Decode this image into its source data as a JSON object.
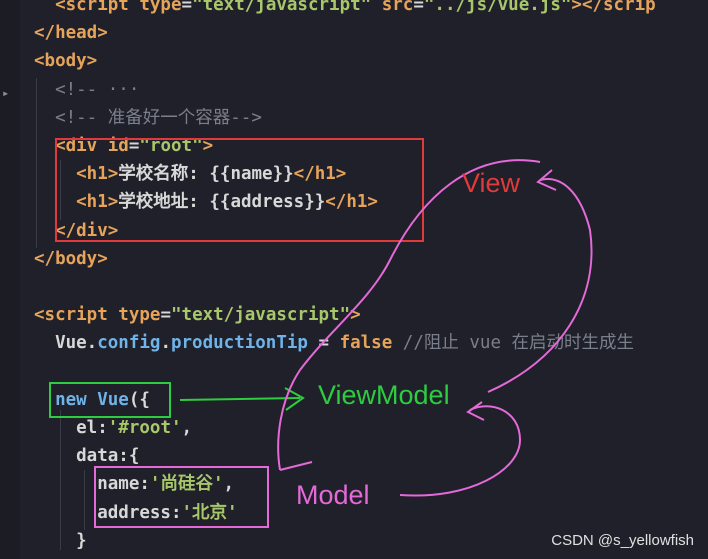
{
  "code_lines": [
    {
      "id": "l1",
      "parts": [
        [
          "tag",
          "  <script "
        ],
        [
          "attr",
          "type"
        ],
        [
          "punc",
          "="
        ],
        [
          "str",
          "\"text/javascript\""
        ],
        [
          "attr",
          " src"
        ],
        [
          "punc",
          "="
        ],
        [
          "str",
          "\"../js/vue.js\""
        ],
        [
          "tag",
          "></scrip"
        ]
      ]
    },
    {
      "id": "l2",
      "parts": [
        [
          "tag",
          "</head>"
        ]
      ]
    },
    {
      "id": "l3",
      "parts": [
        [
          "tag",
          "<body>"
        ]
      ]
    },
    {
      "id": "l4",
      "parts": [
        [
          "cmt",
          "  <!-- ···"
        ]
      ]
    },
    {
      "id": "l5",
      "parts": [
        [
          "cmt",
          "  <!-- 准备好一个容器-->"
        ]
      ]
    },
    {
      "id": "l6",
      "parts": [
        [
          "tag",
          "  <div "
        ],
        [
          "attr",
          "id"
        ],
        [
          "punc",
          "="
        ],
        [
          "str",
          "\"root\""
        ],
        [
          "tag",
          ">"
        ]
      ]
    },
    {
      "id": "l7",
      "parts": [
        [
          "tag",
          "    <h1>"
        ],
        [
          "txt",
          "学校名称: {{name}}"
        ],
        [
          "tag",
          "</h1>"
        ]
      ]
    },
    {
      "id": "l8",
      "parts": [
        [
          "tag",
          "    <h1>"
        ],
        [
          "txt",
          "学校地址: {{address}}"
        ],
        [
          "tag",
          "</h1>"
        ]
      ]
    },
    {
      "id": "l9",
      "parts": [
        [
          "tag",
          "  </div>"
        ]
      ]
    },
    {
      "id": "l10",
      "parts": [
        [
          "tag",
          "</body>"
        ]
      ]
    },
    {
      "id": "l11",
      "parts": [
        [
          "txt",
          ""
        ]
      ]
    },
    {
      "id": "l12",
      "parts": [
        [
          "tag",
          "<script "
        ],
        [
          "attr",
          "type"
        ],
        [
          "punc",
          "="
        ],
        [
          "str",
          "\"text/javascript\""
        ],
        [
          "tag",
          ">"
        ]
      ]
    },
    {
      "id": "l13",
      "parts": [
        [
          "txt",
          "  Vue."
        ],
        [
          "prop",
          "config"
        ],
        [
          "txt",
          "."
        ],
        [
          "prop",
          "productionTip"
        ],
        [
          "txt",
          " = "
        ],
        [
          "bool",
          "false"
        ],
        [
          "cmt",
          " //阻止 vue 在启动时生成生"
        ]
      ]
    },
    {
      "id": "l14",
      "parts": [
        [
          "txt",
          ""
        ]
      ]
    },
    {
      "id": "l15",
      "parts": [
        [
          "kw",
          "  new "
        ],
        [
          "kw",
          "Vue"
        ],
        [
          "txt",
          "({"
        ]
      ]
    },
    {
      "id": "l16",
      "parts": [
        [
          "txt",
          "    el:"
        ],
        [
          "str",
          "'#root'"
        ],
        [
          "txt",
          ","
        ]
      ]
    },
    {
      "id": "l17",
      "parts": [
        [
          "txt",
          "    data:{"
        ]
      ]
    },
    {
      "id": "l18",
      "parts": [
        [
          "txt",
          "      name:"
        ],
        [
          "str",
          "'尚硅谷'"
        ],
        [
          "txt",
          ","
        ]
      ]
    },
    {
      "id": "l19",
      "parts": [
        [
          "txt",
          "      address:"
        ],
        [
          "str",
          "'北京'"
        ]
      ]
    },
    {
      "id": "l20",
      "parts": [
        [
          "txt",
          "    }"
        ]
      ]
    }
  ],
  "annotations": {
    "view_label": "View",
    "viewmodel_label": "ViewModel",
    "model_label": "Model"
  },
  "colors": {
    "view": "#e23a3a",
    "viewmodel": "#2ecc40",
    "model": "#e46ad8"
  },
  "watermark": "CSDN @s_yellowfish"
}
